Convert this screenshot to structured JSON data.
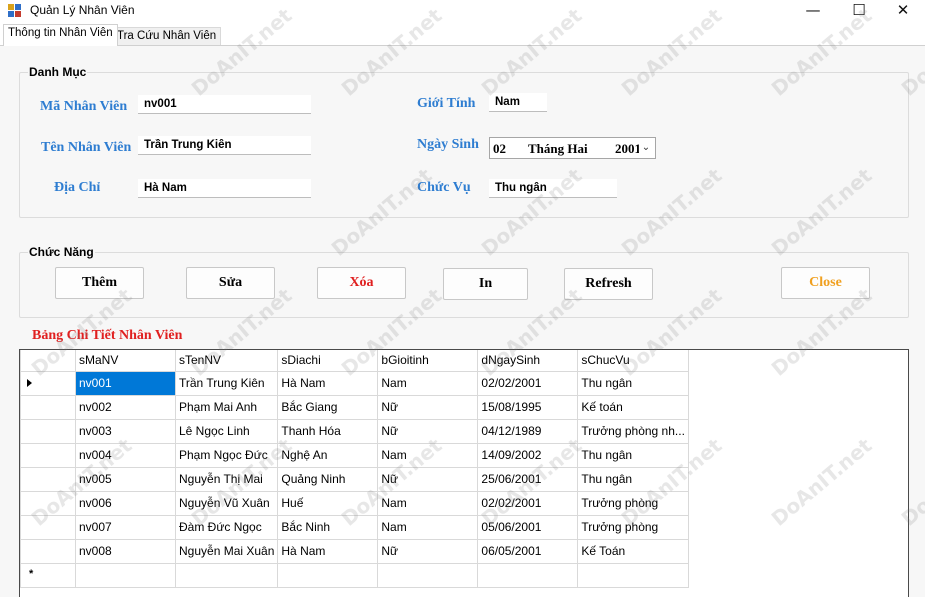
{
  "window": {
    "title": "Quản Lý Nhân Viên",
    "minimize_glyph": "—",
    "maximize_glyph": "☐",
    "close_glyph": "✕"
  },
  "tabs": [
    {
      "label": "Thông tin Nhân Viên",
      "active": true
    },
    {
      "label": "Tra Cứu Nhân Viên",
      "active": false
    }
  ],
  "danh_muc": {
    "title": "Danh Mục",
    "ma_nv_label": "Mã Nhân Viên",
    "ma_nv_value": "nv001",
    "ten_nv_label": "Tên Nhân Viên",
    "ten_nv_value": "Trần Trung Kiên",
    "dia_chi_label": "Địa Chỉ",
    "dia_chi_value": "Hà Nam",
    "gioi_tinh_label": "Giới Tính",
    "gioi_tinh_value": "Nam",
    "ngay_sinh_label": "Ngày Sinh",
    "ngay_sinh_day": "02",
    "ngay_sinh_month": "Tháng Hai",
    "ngay_sinh_year": "2001",
    "chuc_vu_label": "Chức Vụ",
    "chuc_vu_value": "Thu ngân"
  },
  "chuc_nang": {
    "title": "Chức Năng",
    "them": "Thêm",
    "sua": "Sửa",
    "xoa": "Xóa",
    "in": "In",
    "refresh": "Refresh",
    "close": "Close"
  },
  "colors": {
    "label_blue": "#2e7dd1",
    "delete_red": "#e02020",
    "close_orange": "#f0a020",
    "grid_title_red": "#e02020",
    "selection_blue": "#0078d7"
  },
  "grid": {
    "title": "Bảng Chi Tiết Nhân Viên",
    "columns": [
      "sMaNV",
      "sTenNV",
      "sDiachi",
      "bGioitinh",
      "dNgaySinh",
      "sChucVu"
    ],
    "rows": [
      [
        "nv001",
        "Trần Trung Kiên",
        "Hà Nam",
        "Nam",
        "02/02/2001",
        "Thu ngân"
      ],
      [
        "nv002",
        "Phạm Mai Anh",
        "Bắc Giang",
        "Nữ",
        "15/08/1995",
        "Kế toán"
      ],
      [
        "nv003",
        "Lê Ngọc Linh",
        "Thanh Hóa",
        "Nữ",
        "04/12/1989",
        "Trưởng phòng nh..."
      ],
      [
        "nv004",
        "Phạm Ngọc Đức",
        "Nghệ An",
        "Nam",
        "14/09/2002",
        "Thu ngân"
      ],
      [
        "nv005",
        "Nguyễn Thị Mai",
        "Quảng Ninh",
        "Nữ",
        "25/06/2001",
        "Thu ngân"
      ],
      [
        "nv006",
        "Nguyễn Vũ Xuân",
        "Huế",
        "Nam",
        "02/02/2001",
        "Trưởng phòng"
      ],
      [
        "nv007",
        "Đàm Đức Ngọc",
        "Bắc Ninh",
        "Nam",
        "05/06/2001",
        "Trưởng phòng"
      ],
      [
        "nv008",
        "Nguyễn Mai Xuân",
        "Hà Nam",
        "Nữ",
        "06/05/2001",
        "Kế Toán"
      ]
    ],
    "new_row_marker": "*"
  },
  "watermark": "DoAnIT.net"
}
